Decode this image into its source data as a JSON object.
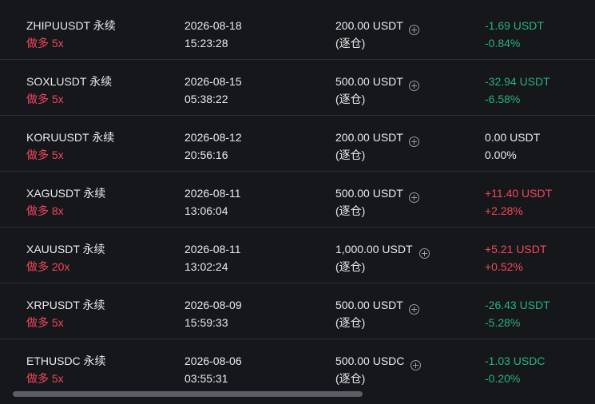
{
  "positions": [
    {
      "symbol": "ZHIPUUSDT 永续",
      "side": "做多 5x",
      "date": "2026-08-18",
      "time": "15:23:28",
      "margin": "200.00 USDT",
      "margin_mode": "(逐仓)",
      "pnl": "-1.69 USDT",
      "pnl_pct": "-0.84%",
      "pnl_color": "green"
    },
    {
      "symbol": "SOXLUSDT 永续",
      "side": "做多 5x",
      "date": "2026-08-15",
      "time": "05:38:22",
      "margin": "500.00 USDT",
      "margin_mode": "(逐仓)",
      "pnl": "-32.94 USDT",
      "pnl_pct": "-6.58%",
      "pnl_color": "green"
    },
    {
      "symbol": "KORUUSDT 永续",
      "side": "做多 5x",
      "date": "2026-08-12",
      "time": "20:56:16",
      "margin": "200.00 USDT",
      "margin_mode": "(逐仓)",
      "pnl": "0.00 USDT",
      "pnl_pct": "0.00%",
      "pnl_color": "white"
    },
    {
      "symbol": "XAGUSDT 永续",
      "side": "做多 8x",
      "date": "2026-08-11",
      "time": "13:06:04",
      "margin": "500.00 USDT",
      "margin_mode": "(逐仓)",
      "pnl": "+11.40 USDT",
      "pnl_pct": "+2.28%",
      "pnl_color": "red"
    },
    {
      "symbol": "XAUUSDT 永续",
      "side": "做多 20x",
      "date": "2026-08-11",
      "time": "13:02:24",
      "margin": "1,000.00 USDT",
      "margin_mode": "(逐仓)",
      "pnl": "+5.21 USDT",
      "pnl_pct": "+0.52%",
      "pnl_color": "red"
    },
    {
      "symbol": "XRPUSDT 永续",
      "side": "做多 5x",
      "date": "2026-08-09",
      "time": "15:59:33",
      "margin": "500.00 USDT",
      "margin_mode": "(逐仓)",
      "pnl": "-26.43 USDT",
      "pnl_pct": "-5.28%",
      "pnl_color": "green"
    },
    {
      "symbol": "ETHUSDC 永续",
      "side": "做多 5x",
      "date": "2026-08-06",
      "time": "03:55:31",
      "margin": "500.00 USDC",
      "margin_mode": "(逐仓)",
      "pnl": "-1.03 USDC",
      "pnl_pct": "-0.20%",
      "pnl_color": "green"
    }
  ],
  "icons": {
    "add_margin": "plus-circle-icon"
  },
  "colors": {
    "background": "#16171b",
    "long_red": "#f0485d",
    "loss_green": "#27b37c",
    "text": "#e9eaec"
  }
}
